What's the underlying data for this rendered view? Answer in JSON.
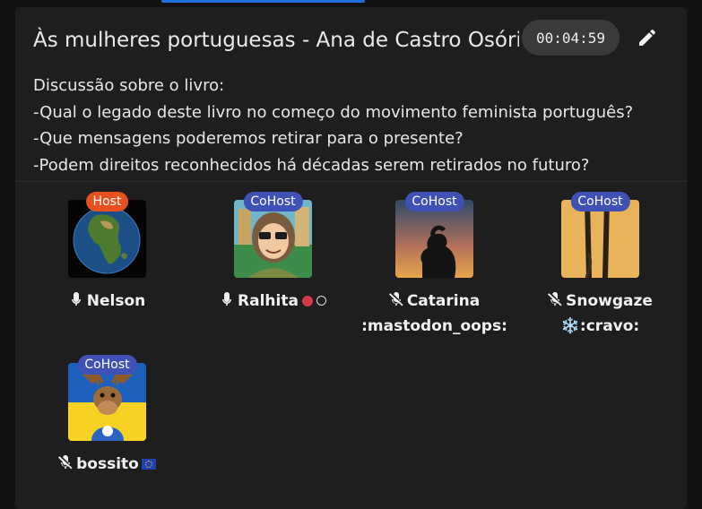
{
  "room": {
    "title": "Às mulheres portuguesas - Ana de Castro Osório",
    "timer": "00:04:59",
    "description": [
      "Discussão sobre o livro:",
      "-Qual o legado deste livro no começo do movimento feminista português?",
      "-Que mensagens poderemos retirar para o presente?",
      "-Podem direitos reconhecidos há décadas serem retirados no futuro?"
    ]
  },
  "speakers": [
    {
      "name": "Nelson",
      "role": "Host",
      "mic": "on"
    },
    {
      "name": "Ralhita",
      "role": "CoHost",
      "mic": "on",
      "extra": "🔴 ⚪"
    },
    {
      "name": "Catarina",
      "name2": ":mastodon_oops:",
      "role": "CoHost",
      "mic": "muted"
    },
    {
      "name": "Snowgaze",
      "name2": "❄️:cravo:",
      "role": "CoHost",
      "mic": "muted"
    },
    {
      "name": "bossito",
      "role": "CoHost",
      "mic": "muted",
      "extra": "🇪🇺"
    }
  ],
  "colors": {
    "host_badge": "#e7501f",
    "cohost_badge": "#3f51b5",
    "panel": "#1e1e1e",
    "background": "#121212"
  },
  "icons": [
    "pencil-icon",
    "mic-icon",
    "mic-off-icon"
  ]
}
